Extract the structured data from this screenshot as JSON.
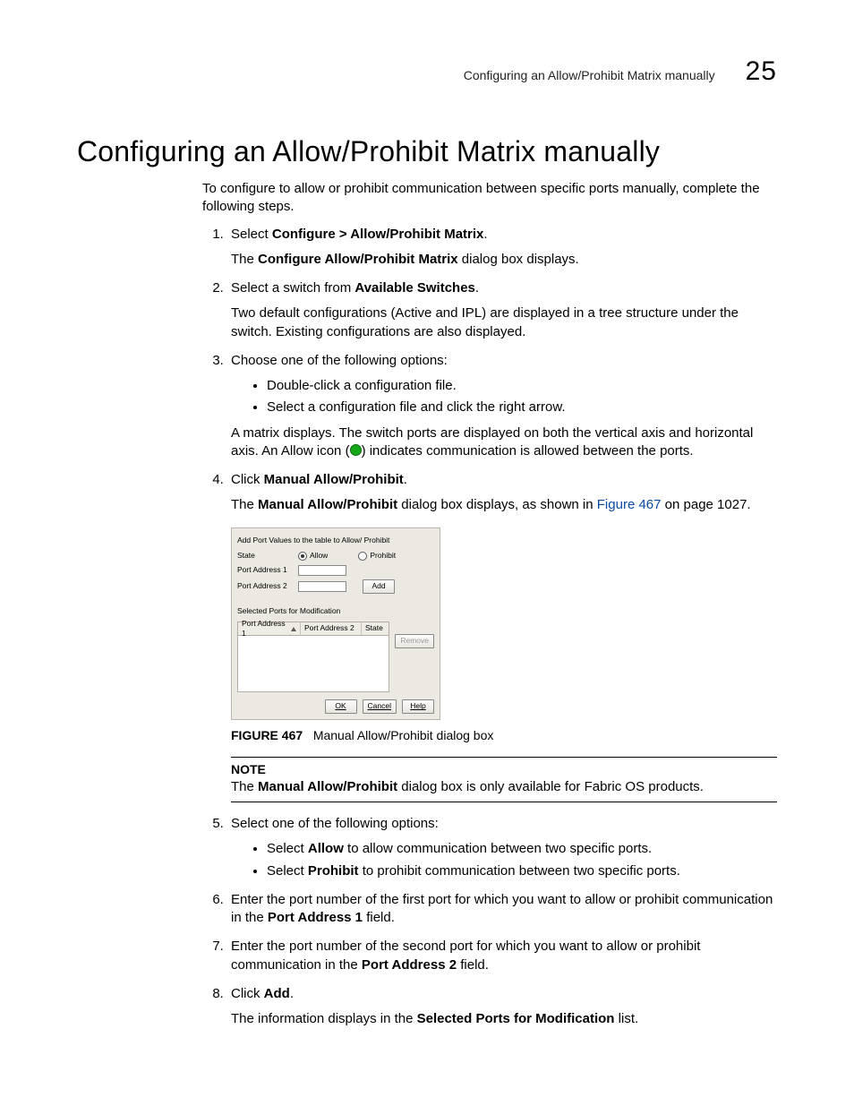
{
  "header": {
    "running_title": "Configuring an Allow/Prohibit Matrix manually",
    "chapter_number": "25"
  },
  "title": "Configuring an Allow/Prohibit Matrix manually",
  "intro": "To configure to allow or prohibit communication between specific ports manually, complete the following steps.",
  "steps": {
    "s1": {
      "lead": "Select ",
      "bold": "Configure > Allow/Prohibit Matrix",
      "tail": ".",
      "p2a": "The ",
      "p2b": "Configure Allow/Prohibit Matrix",
      "p2c": " dialog box displays."
    },
    "s2": {
      "lead": "Select a switch from ",
      "bold": "Available Switches",
      "tail": ".",
      "p2": "Two default configurations (Active and IPL) are displayed in a tree structure under the switch. Existing configurations are also displayed."
    },
    "s3": {
      "text": "Choose one of the following options:",
      "b1": "Double-click a configuration file.",
      "b2": "Select a configuration file and click the right arrow.",
      "p2a": "A matrix displays. The switch ports are displayed on both the vertical axis and horizontal axis. An Allow icon (",
      "p2b": ") indicates communication is allowed between the ports."
    },
    "s4": {
      "lead": "Click ",
      "bold": "Manual Allow/Prohibit",
      "tail": ".",
      "p2a": "The ",
      "p2b": "Manual Allow/Prohibit",
      "p2c": " dialog box displays, as shown in ",
      "xref": "Figure 467",
      "p2d": " on page 1027."
    },
    "s5": {
      "text": "Select one of the following options:",
      "b1a": "Select ",
      "b1b": "Allow",
      "b1c": " to allow communication between two specific ports.",
      "b2a": "Select ",
      "b2b": "Prohibit",
      "b2c": " to prohibit communication between two specific ports."
    },
    "s6": {
      "a": "Enter the port number of the first port for which you want to allow or prohibit communication in the ",
      "b": "Port Address 1",
      "c": " field."
    },
    "s7": {
      "a": "Enter the port number of the second port for which you want to allow or prohibit communication in the ",
      "b": "Port Address 2",
      "c": " field."
    },
    "s8": {
      "lead": "Click ",
      "bold": "Add",
      "tail": ".",
      "p2a": "The information displays in the ",
      "p2b": "Selected Ports for Modification",
      "p2c": " list."
    }
  },
  "dialog": {
    "sec1_title": "Add Port Values to the table to Allow/ Prohibit",
    "state_label": "State",
    "allow_label": "Allow",
    "prohibit_label": "Prohibit",
    "pa1_label": "Port Address 1",
    "pa2_label": "Port Address 2",
    "add_btn": "Add",
    "sec2_title": "Selected Ports for Modification",
    "th1": "Port Address 1",
    "th2": "Port Address 2",
    "th3": "State",
    "remove_btn": "Remove",
    "ok_btn": "OK",
    "cancel_btn": "Cancel",
    "help_btn": "Help"
  },
  "figure": {
    "label": "FIGURE 467",
    "caption": "Manual Allow/Prohibit dialog box"
  },
  "note": {
    "label": "NOTE",
    "a": "The ",
    "b": "Manual Allow/Prohibit",
    "c": " dialog box is only available for Fabric OS products."
  }
}
